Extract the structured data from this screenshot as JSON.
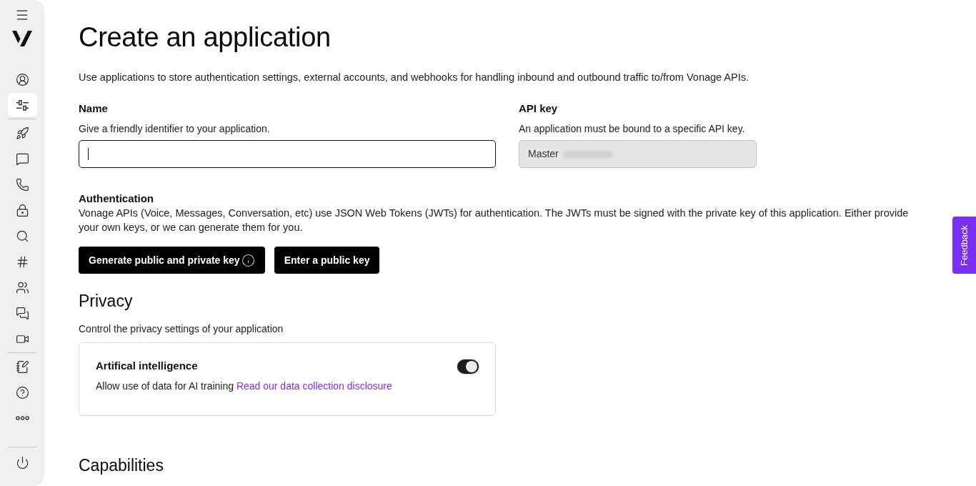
{
  "sidebar": {
    "nav_items": [
      {
        "selected": false
      },
      {
        "selected": true
      },
      {
        "selected": false
      },
      {
        "selected": false
      },
      {
        "selected": false
      },
      {
        "selected": false
      },
      {
        "selected": false
      },
      {
        "selected": false
      },
      {
        "selected": false
      },
      {
        "selected": false
      },
      {
        "selected": false
      },
      {
        "selected": false
      },
      {
        "selected": false
      },
      {
        "selected": false
      },
      {
        "selected": false
      }
    ]
  },
  "page": {
    "title": "Create an application",
    "description": "Use applications to store authentication settings, external accounts, and webhooks for handling inbound and outbound traffic to/from Vonage APIs."
  },
  "name_field": {
    "label": "Name",
    "help": "Give a friendly identifier to your application.",
    "focused": true
  },
  "api_key_field": {
    "label": "API key",
    "help": "An application must be bound to a specific API key.",
    "value": "Master",
    "disabled": true,
    "masked": true
  },
  "authentication": {
    "label": "Authentication",
    "description": "Vonage APIs (Voice, Messages, Conversation, etc) use JSON Web Tokens (JWTs) for authentication. The JWTs must be signed with the private key of this application. Either provide your own keys, or we can generate them for you.",
    "buttons": [
      {
        "label": "Generate public and private key",
        "info": true
      },
      {
        "label": "Enter a public key",
        "info": false
      }
    ]
  },
  "privacy": {
    "heading": "Privacy",
    "description": "Control the privacy settings of your application",
    "settings": [
      {
        "title": "Artifical intelligence",
        "description": "Allow use of data for AI training",
        "link": "Read our data collection disclosure",
        "on": true
      }
    ]
  },
  "capabilities": {
    "heading": "Capabilities"
  },
  "feedback_tab": {
    "label": "Feedback"
  }
}
